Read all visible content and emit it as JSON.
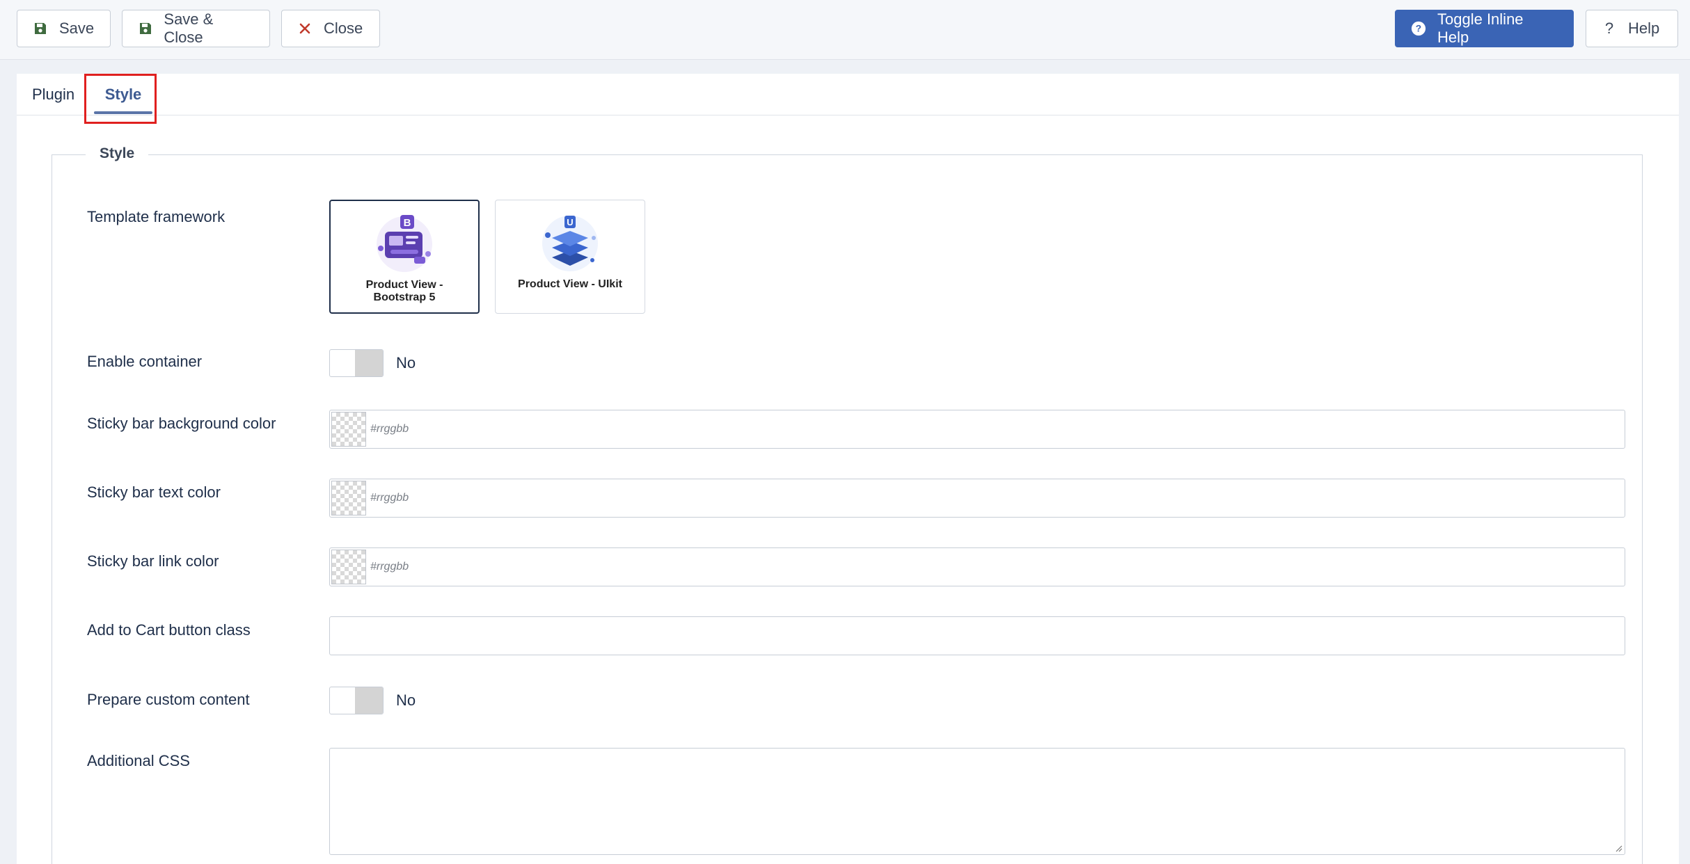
{
  "toolbar": {
    "save_label": "Save",
    "save_close_label": "Save & Close",
    "close_label": "Close",
    "toggle_help_label": "Toggle Inline Help",
    "help_label": "Help"
  },
  "tabs": [
    {
      "label": "Plugin"
    },
    {
      "label": "Style"
    }
  ],
  "fieldset": {
    "legend": "Style",
    "template_framework": {
      "label": "Template framework",
      "options": [
        {
          "title": "Product View - Bootstrap 5",
          "selected": true
        },
        {
          "title": "Product View - UIkit",
          "selected": false
        }
      ]
    },
    "enable_container": {
      "label": "Enable container",
      "state": "No"
    },
    "sticky_bg": {
      "label": "Sticky bar background color",
      "placeholder": "#rrggbb"
    },
    "sticky_text": {
      "label": "Sticky bar text color",
      "placeholder": "#rrggbb"
    },
    "sticky_link": {
      "label": "Sticky bar link color",
      "placeholder": "#rrggbb"
    },
    "cart_class": {
      "label": "Add to Cart button class",
      "value": ""
    },
    "custom_content": {
      "label": "Prepare custom content",
      "state": "No"
    },
    "additional_css": {
      "label": "Additional CSS",
      "value": ""
    }
  },
  "colors": {
    "primary": "#3a64b5",
    "highlight": "#e0201f",
    "active_tab": "#3d5a91",
    "save_icon": "#3f6b3f",
    "close_icon": "#c0392b"
  }
}
